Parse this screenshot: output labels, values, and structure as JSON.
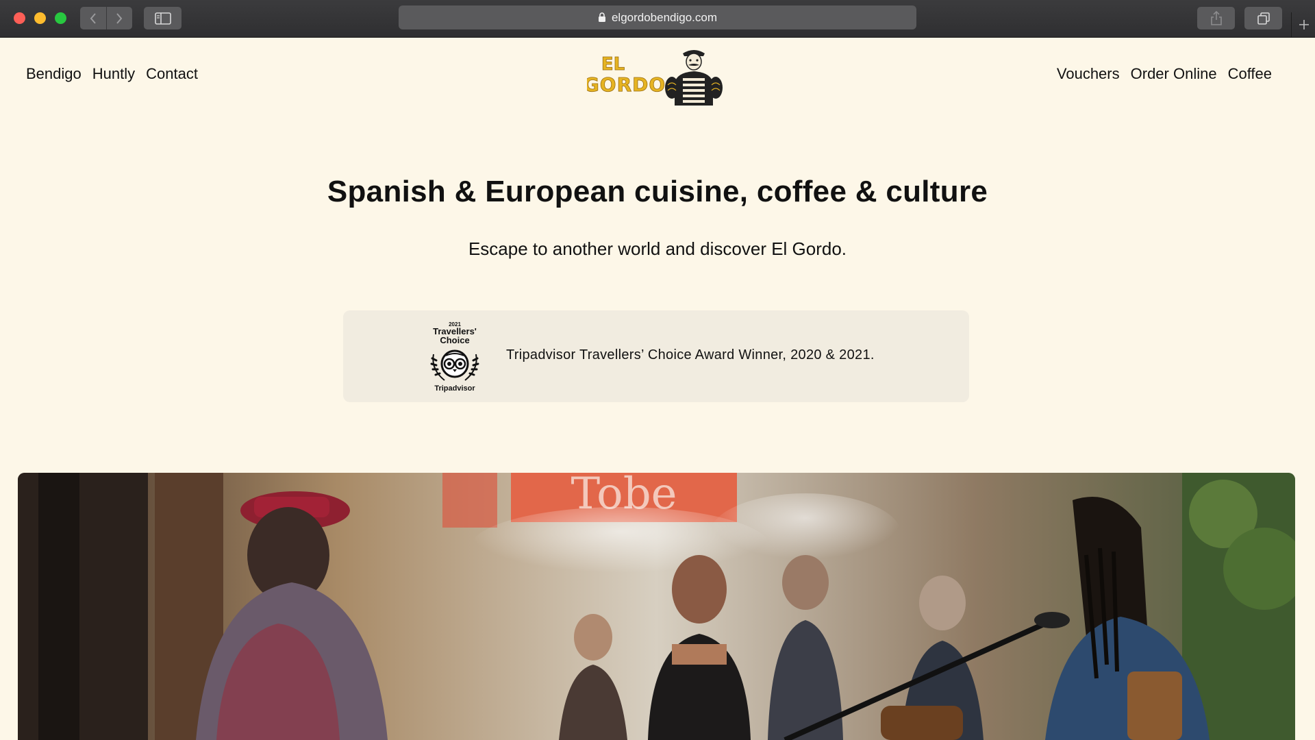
{
  "browser": {
    "url": "elgordobendigo.com"
  },
  "nav": {
    "left": [
      "Bendigo",
      "Huntly",
      "Contact"
    ],
    "right": [
      "Vouchers",
      "Order Online",
      "Coffee"
    ]
  },
  "logo": {
    "text_line1": "EL",
    "text_line2": "GORDO"
  },
  "hero": {
    "headline": "Spanish & European cuisine, coffee & culture",
    "subhead": "Escape to another world and discover El Gordo."
  },
  "award": {
    "badge_year": "2021",
    "badge_title_1": "Travellers'",
    "badge_title_2": "Choice",
    "badge_brand": "Tripadvisor",
    "text": "Tripadvisor Travellers’ Choice Award Winner, 2020 & 2021."
  },
  "photo": {
    "sign_text": "Tobe"
  },
  "colors": {
    "page_background": "#fdf7e8",
    "award_card": "#f1ece0",
    "logo_gold": "#e6b422",
    "chrome": "#333335"
  }
}
